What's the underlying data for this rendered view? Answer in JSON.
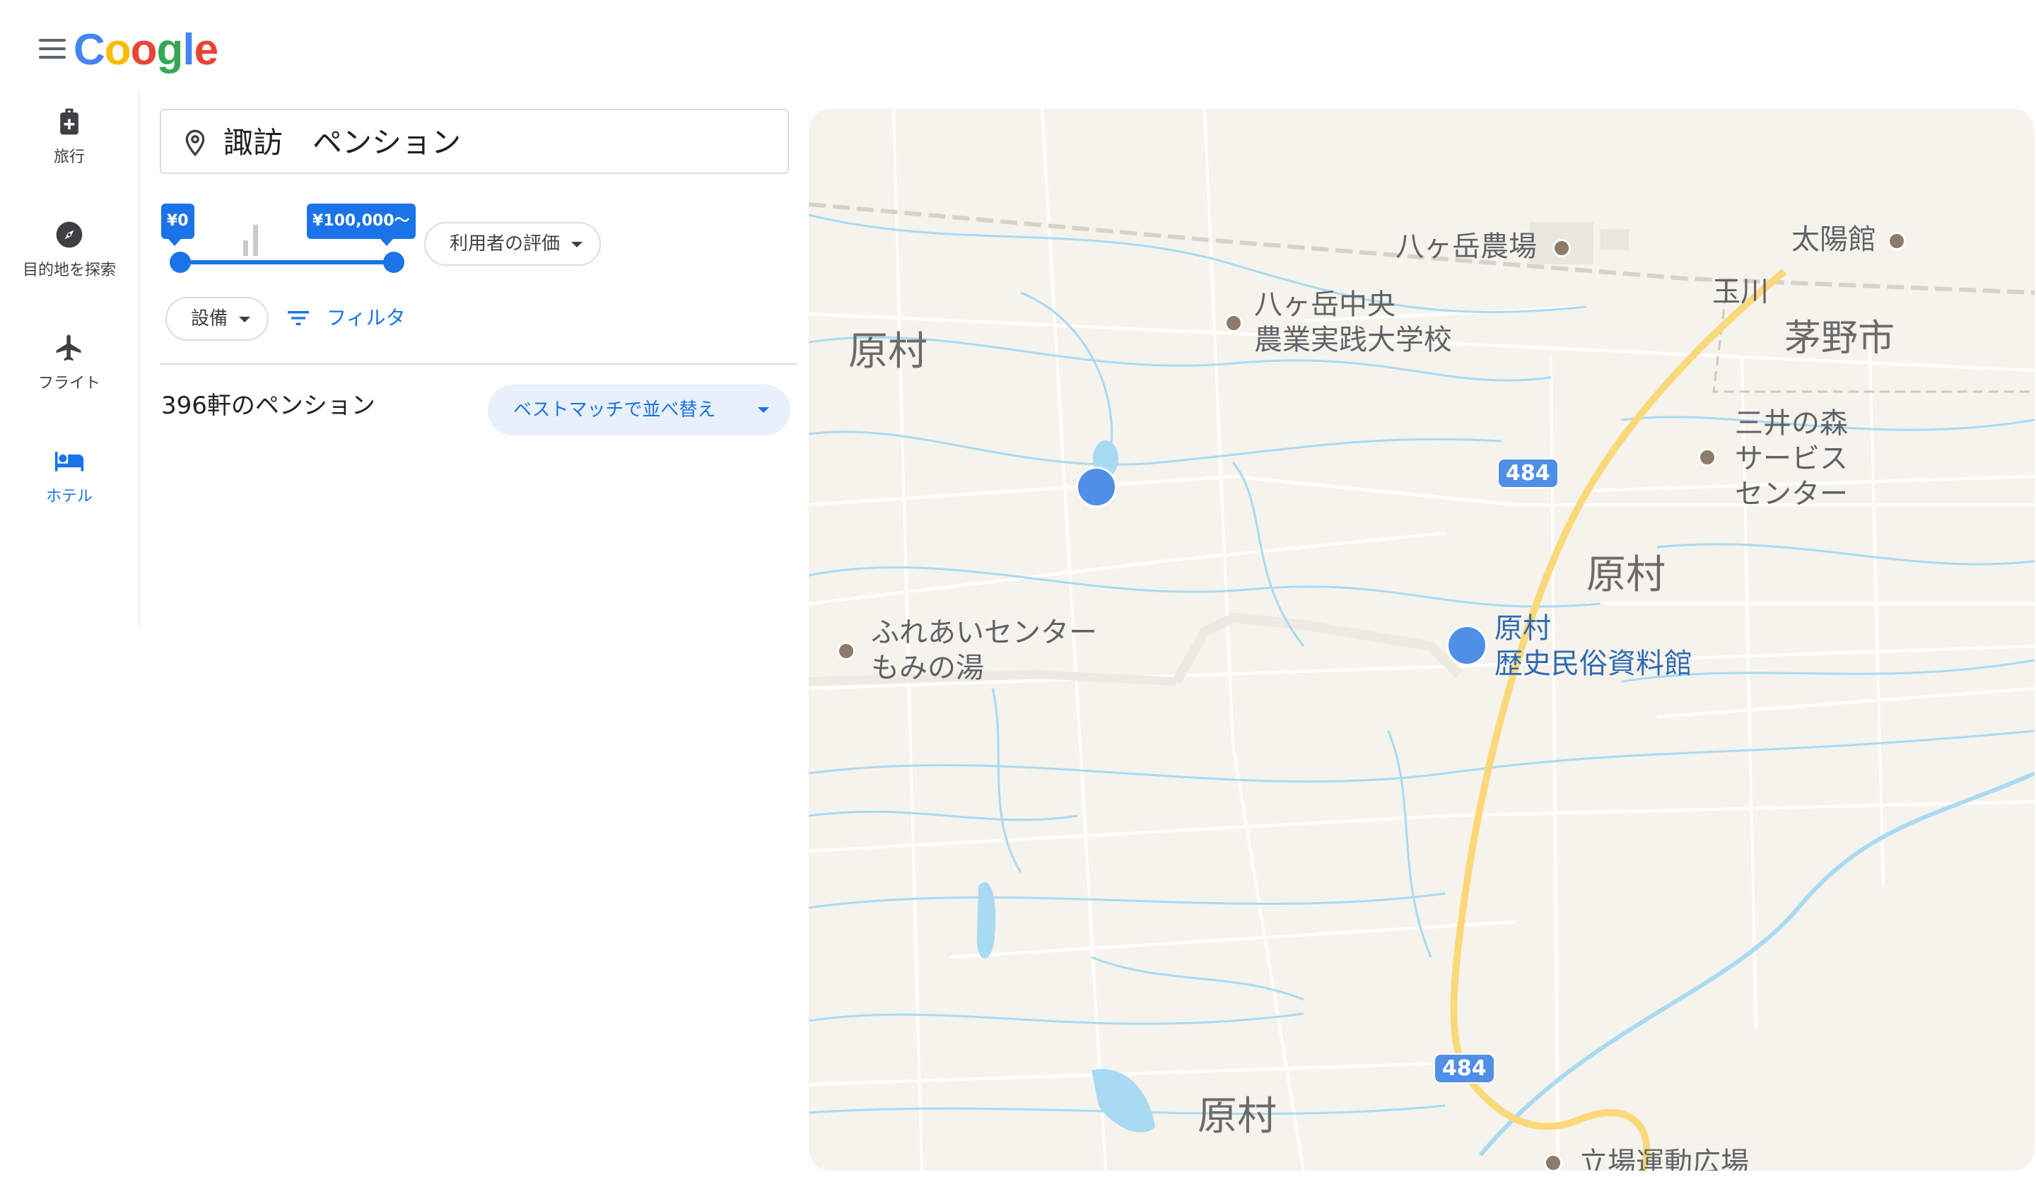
{
  "header": {
    "logo": "Coogle",
    "menu_icon": "hamburger-menu-icon"
  },
  "nav": {
    "items": [
      {
        "label": "旅行",
        "icon": "luggage-icon"
      },
      {
        "label": "目的地を探索",
        "icon": "compass-icon"
      },
      {
        "label": "フライト",
        "icon": "airplane-icon"
      },
      {
        "label": "ホテル",
        "icon": "bed-icon",
        "active": true
      }
    ]
  },
  "search": {
    "query": "諏訪　ペンション",
    "icon": "location-pin-icon"
  },
  "price": {
    "min_label": "¥0",
    "max_label": "¥100,000〜",
    "min_value": 0,
    "max_value": 100000
  },
  "filters": {
    "rating_label": "利用者の評価",
    "amenities_label": "設備",
    "filter_label": "フィルタ"
  },
  "results": {
    "count_text": "396軒のペンション",
    "sort_label": "ベストマッチで並べ替え"
  },
  "map": {
    "labels": {
      "farm": "八ヶ岳農場",
      "school_line1": "八ヶ岳中央",
      "school_line2": "農業実践大学校",
      "area_nw": "原村",
      "taiyokan": "太陽館",
      "tamagawa": "玉川",
      "chino": "茅野市",
      "service_line1": "三井の森",
      "service_line2": "サービス",
      "service_line3": "センター",
      "area_center": "原村",
      "fureai_line1": "ふれあいセンター",
      "fureai_line2": "もみの湯",
      "museum_line1": "原村",
      "museum_line2": "歴史民俗資料館",
      "area_s": "原村",
      "sports": "立場運動広場"
    },
    "route_number": "484",
    "colors": {
      "land": "#f6f3ec",
      "water": "#a8daf4",
      "highway": "#fbd97a",
      "road": "#ffffff"
    }
  }
}
